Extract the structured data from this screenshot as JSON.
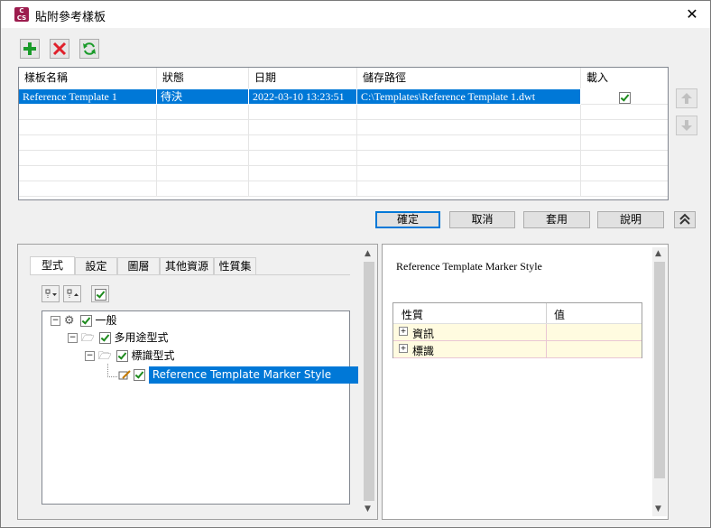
{
  "window": {
    "title": "貼附參考樣板",
    "app_icon_text": "C"
  },
  "toolbar": {
    "add_icon": "plus-icon",
    "delete_icon": "x-icon",
    "refresh_icon": "refresh-icon"
  },
  "grid": {
    "columns": [
      "樣板名稱",
      "狀態",
      "日期",
      "儲存路徑",
      "載入"
    ],
    "rows": [
      {
        "name": "Reference Template 1",
        "status": "待決",
        "date": "2022-03-10 13:23:51",
        "path": "C:\\Templates\\Reference Template 1.dwt",
        "loaded": true
      }
    ]
  },
  "buttons": {
    "ok": "確定",
    "cancel": "取消",
    "apply": "套用",
    "help": "說明"
  },
  "tabs": [
    "型式",
    "設定",
    "圖層",
    "其他資源",
    "性質集"
  ],
  "tree": {
    "root": "一般",
    "child": "多用途型式",
    "grandchild": "標識型式",
    "leaf": "Reference Template Marker Style"
  },
  "right_panel": {
    "heading": "Reference Template Marker Style",
    "columns": [
      "性質",
      "值"
    ],
    "rows": [
      "資訊",
      "標識"
    ]
  }
}
